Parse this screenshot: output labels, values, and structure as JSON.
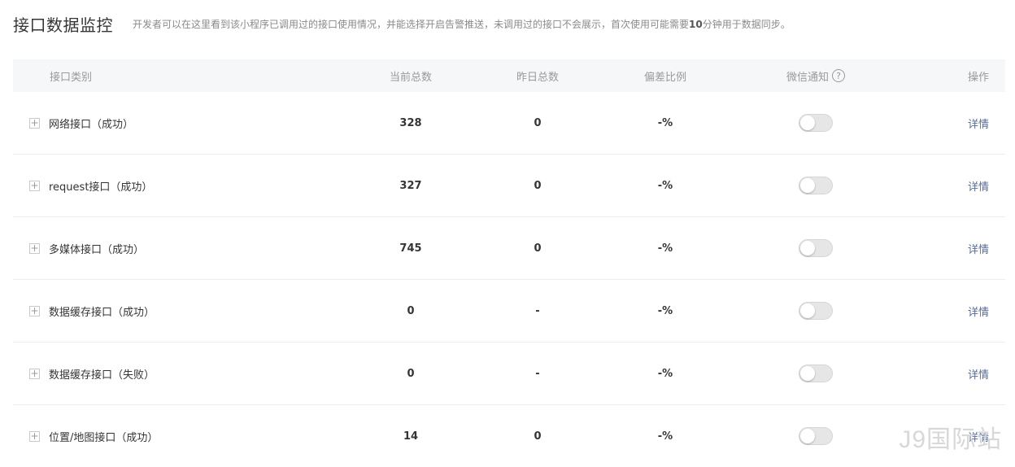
{
  "page": {
    "title": "接口数据监控",
    "desc_pre": "开发者可以在这里看到该小程序已调用过的接口使用情况，并能选择开启告警推送，未调用过的接口不会展示，首次使用可能需要",
    "desc_bold": "10",
    "desc_post": "分钟用于数据同步。"
  },
  "table": {
    "headers": {
      "type": "接口类别",
      "current": "当前总数",
      "yesterday": "昨日总数",
      "deviation": "偏差比例",
      "wechat": "微信通知",
      "help_icon": "?",
      "action": "操作"
    },
    "rows": [
      {
        "expand": "+",
        "name": "网络接口（成功）",
        "current": "328",
        "yesterday": "0",
        "deviation": "-%",
        "action": "详情",
        "notify": false
      },
      {
        "expand": "+",
        "name": "request接口（成功）",
        "current": "327",
        "yesterday": "0",
        "deviation": "-%",
        "action": "详情",
        "notify": false
      },
      {
        "expand": "+",
        "name": "多媒体接口（成功）",
        "current": "745",
        "yesterday": "0",
        "deviation": "-%",
        "action": "详情",
        "notify": false
      },
      {
        "expand": "+",
        "name": "数据缓存接口（成功）",
        "current": "0",
        "yesterday": "-",
        "deviation": "-%",
        "action": "详情",
        "notify": false
      },
      {
        "expand": "+",
        "name": "数据缓存接口（失败）",
        "current": "0",
        "yesterday": "-",
        "deviation": "-%",
        "action": "详情",
        "notify": false
      },
      {
        "expand": "+",
        "name": "位置/地图接口（成功）",
        "current": "14",
        "yesterday": "0",
        "deviation": "-%",
        "action": "详情",
        "notify": false
      }
    ]
  },
  "watermark": "J9国际站"
}
